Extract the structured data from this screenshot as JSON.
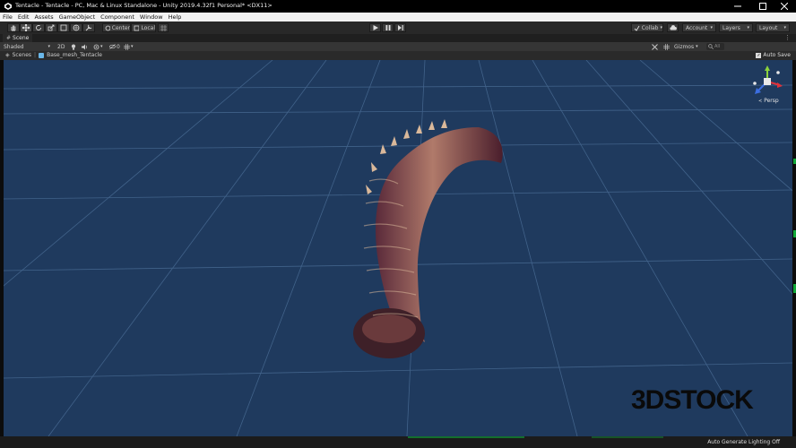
{
  "window": {
    "title": "Tentacle - Tentacle - PC, Mac & Linux Standalone - Unity 2019.4.32f1 Personal* <DX11>"
  },
  "menu": [
    "File",
    "Edit",
    "Assets",
    "GameObject",
    "Component",
    "Window",
    "Help"
  ],
  "toolbar": {
    "pivot_label": "Center",
    "space_label": "Local",
    "collab_label": "Collab",
    "account_label": "Account",
    "layers_label": "Layers",
    "layout_label": "Layout"
  },
  "scene_tab": {
    "label": "Scene"
  },
  "scene_toolbar": {
    "shading_mode": "Shaded",
    "mode_2d": "2D",
    "hidden_count": "0",
    "gizmos_label": "Gizmos",
    "search_placeholder": "All"
  },
  "breadcrumb": {
    "root": "Scenes",
    "item": "Base_mesh_Tentacle",
    "auto_save": "Auto Save"
  },
  "viewport": {
    "projection_label": "Persp",
    "watermark_a": "3D",
    "watermark_b": "STOCK",
    "colors": {
      "background": "#1f3a5e",
      "grid": "#4a6d95",
      "gizmo_x": "#e0323a",
      "gizmo_y": "#8cd23c",
      "gizmo_z": "#3c6ee0"
    }
  },
  "status": {
    "lighting": "Auto Generate Lighting Off"
  }
}
